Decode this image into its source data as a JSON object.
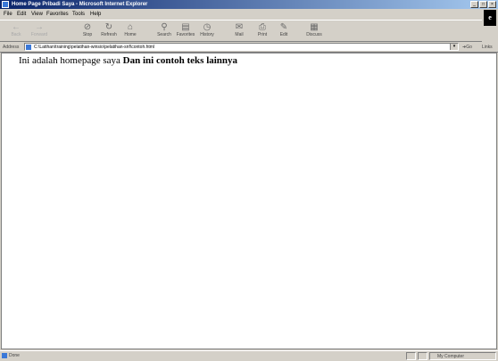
{
  "window": {
    "title": "Home Page Pribadi Saya - Microsoft Internet Explorer",
    "controls": {
      "minimize": "_",
      "maximize": "□",
      "close": "×"
    }
  },
  "menu": [
    "File",
    "Edit",
    "View",
    "Favorites",
    "Tools",
    "Help"
  ],
  "toolbar": {
    "back": "Back",
    "forward": "Forward",
    "stop": "Stop",
    "refresh": "Refresh",
    "home": "Home",
    "search": "Search",
    "favorites": "Favorites",
    "history": "History",
    "mail": "Mail",
    "print": "Print",
    "edit": "Edit",
    "discuss": "Discuss"
  },
  "address": {
    "label": "Address",
    "url": "C:\\Latihan\\training\\pelatihan-winsio\\pelatihan-snf\\contoh.html",
    "go": "Go",
    "links": "Links"
  },
  "content": {
    "normal_text": "Ini adalah homepage saya ",
    "bold_text": "Dan ini contoh teks lainnya"
  },
  "status": {
    "text": "Done",
    "zone": "My Computer"
  }
}
